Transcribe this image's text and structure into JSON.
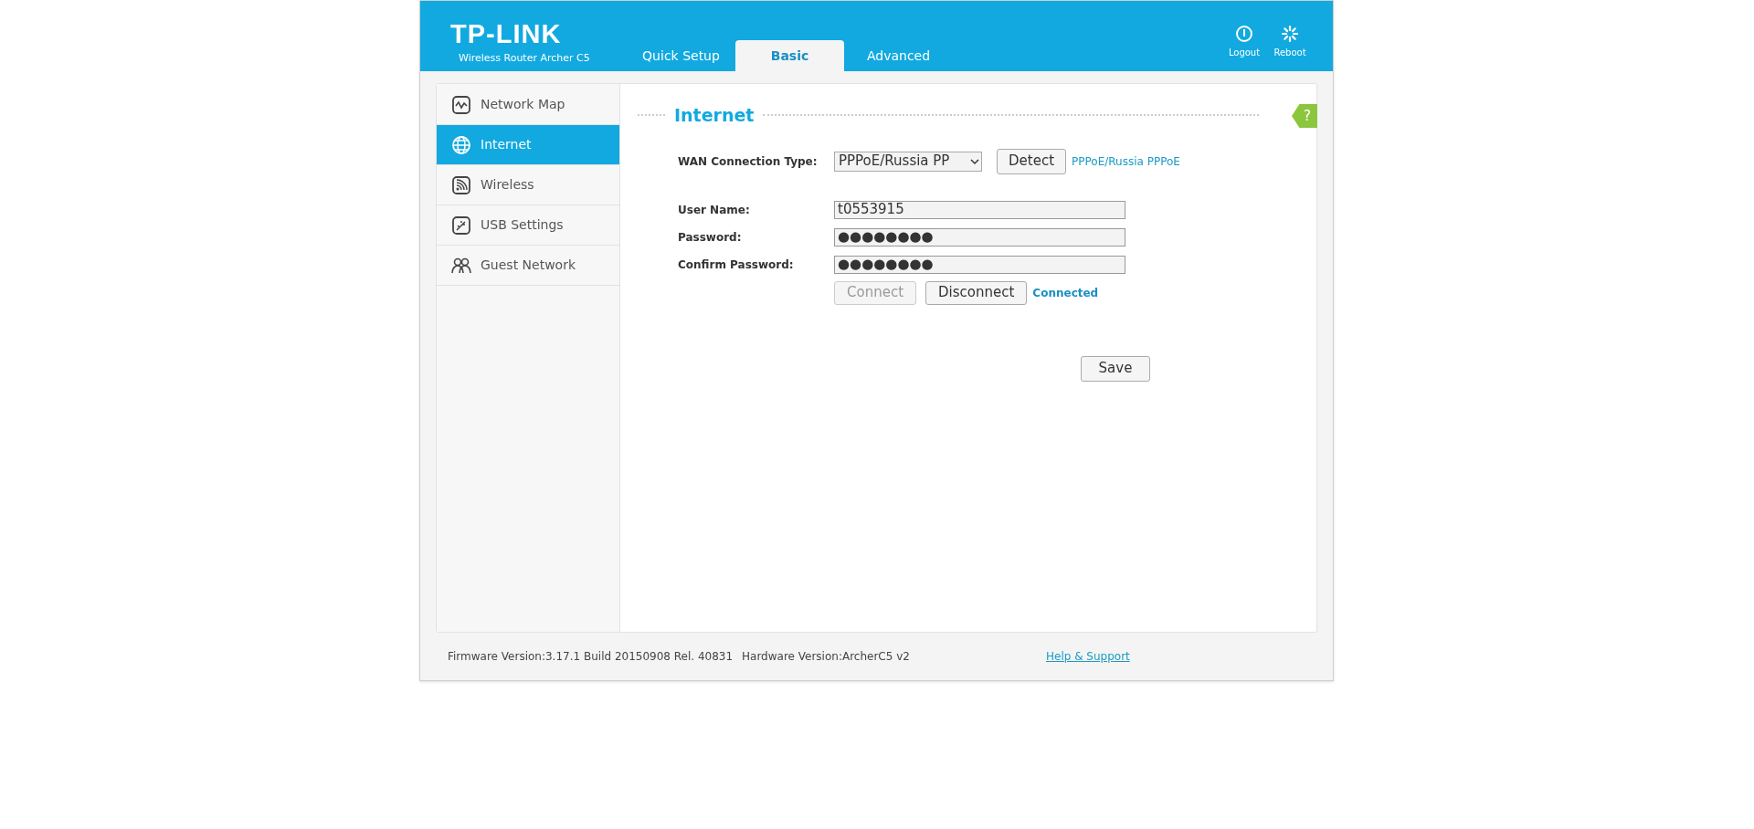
{
  "logo": {
    "brand": "TP-LINK",
    "model": "Wireless Router Archer C5"
  },
  "tabs": [
    {
      "label": "Quick Setup",
      "selected": false
    },
    {
      "label": "Basic",
      "selected": true
    },
    {
      "label": "Advanced",
      "selected": false
    }
  ],
  "header_actions": [
    {
      "kind": "logout",
      "label": "Logout"
    },
    {
      "kind": "reboot",
      "label": "Reboot"
    }
  ],
  "sidebar": {
    "items": [
      {
        "kind": "map",
        "label": "Network Map",
        "selected": false
      },
      {
        "kind": "globe",
        "label": "Internet",
        "selected": true
      },
      {
        "kind": "wireless",
        "label": "Wireless",
        "selected": false
      },
      {
        "kind": "usb",
        "label": "USB Settings",
        "selected": false
      },
      {
        "kind": "guest",
        "label": "Guest Network",
        "selected": false
      }
    ]
  },
  "help_tab": {
    "label": "?"
  },
  "section": {
    "title": "Internet"
  },
  "wan": {
    "label": "WAN Connection Type:",
    "value": "PPPoE/Russia PP",
    "detect": "Detect",
    "detected": "PPPoE/Russia PPPoE"
  },
  "fields": [
    {
      "label": "User Name:",
      "value": "t0553915"
    },
    {
      "label": "Password:",
      "value": "●●●●●●●●"
    },
    {
      "label": "Confirm Password:",
      "value": "●●●●●●●●"
    }
  ],
  "connection_buttons": [
    {
      "label": "Connect",
      "disabled": true
    },
    {
      "label": "Disconnect",
      "disabled": false
    }
  ],
  "connection_status": "Connected",
  "save": "Save",
  "footer": {
    "firmware": "Firmware Version:3.17.1 Build 20150908 Rel. 40831",
    "hardware": "Hardware Version:ArcherC5 v2",
    "help_link": "Help & Support"
  }
}
